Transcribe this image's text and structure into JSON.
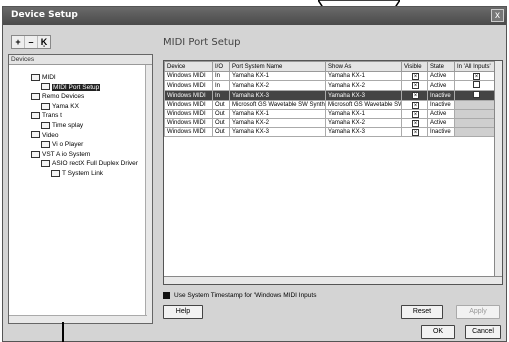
{
  "window": {
    "title": "Device Setup",
    "close_label": "x"
  },
  "toolbar": {
    "add": "+",
    "remove": "–",
    "reset": "Ķ"
  },
  "devices": {
    "header": "Devices",
    "items": [
      {
        "label": "MIDI",
        "indent": 0
      },
      {
        "label": "MIDI Port Setup",
        "indent": 1,
        "selected": true
      },
      {
        "label": "Remo    Devices",
        "indent": 0
      },
      {
        "label": "Yama    KX",
        "indent": 1
      },
      {
        "label": "Trans   t",
        "indent": 0
      },
      {
        "label": "Time    splay",
        "indent": 1
      },
      {
        "label": "Video",
        "indent": 0
      },
      {
        "label": "Vi    o Player",
        "indent": 1
      },
      {
        "label": "VST A    io System",
        "indent": 0
      },
      {
        "label": "ASIO    rectX Full Duplex Driver",
        "indent": 1
      },
      {
        "label": "T System Link",
        "indent": 2
      }
    ]
  },
  "section_title": "MIDI Port Setup",
  "table": {
    "columns": [
      "Device",
      "I/O",
      "Port System Name",
      "Show As",
      "Visible",
      "State",
      "In 'All Inputs'"
    ],
    "rows": [
      {
        "device": "Windows MIDI",
        "io": "In",
        "port": "Yamaha KX-1",
        "show": "Yamaha KX-1",
        "visible": true,
        "state": "Active",
        "all_inputs": "checked"
      },
      {
        "device": "Windows MIDI",
        "io": "In",
        "port": "Yamaha KX-2",
        "show": "Yamaha KX-2",
        "visible": true,
        "state": "Active",
        "all_inputs": "empty"
      },
      {
        "device": "Windows MIDI",
        "io": "In",
        "port": "Yamaha KX-3",
        "show": "Yamaha KX-3",
        "visible": true,
        "state": "Inactive",
        "all_inputs": "empty",
        "selected": true
      },
      {
        "device": "Windows MIDI",
        "io": "Out",
        "port": "Microsoft GS Wavetable SW Synth",
        "show": "Microsoft GS Wavetable SW",
        "visible": true,
        "state": "Inactive",
        "all_inputs": "none"
      },
      {
        "device": "Windows MIDI",
        "io": "Out",
        "port": "Yamaha KX-1",
        "show": "Yamaha KX-1",
        "visible": true,
        "state": "Active",
        "all_inputs": "none"
      },
      {
        "device": "Windows MIDI",
        "io": "Out",
        "port": "Yamaha KX-2",
        "show": "Yamaha KX-2",
        "visible": true,
        "state": "Active",
        "all_inputs": "none"
      },
      {
        "device": "Windows MIDI",
        "io": "Out",
        "port": "Yamaha KX-3",
        "show": "Yamaha KX-3",
        "visible": true,
        "state": "Inactive",
        "all_inputs": "none"
      }
    ]
  },
  "timestamp_label": "Use System Timestamp for 'Windows MIDI Inputs",
  "buttons": {
    "help": "Help",
    "reset": "Reset",
    "apply": "Apply",
    "ok": "OK",
    "cancel": "Cancel"
  }
}
